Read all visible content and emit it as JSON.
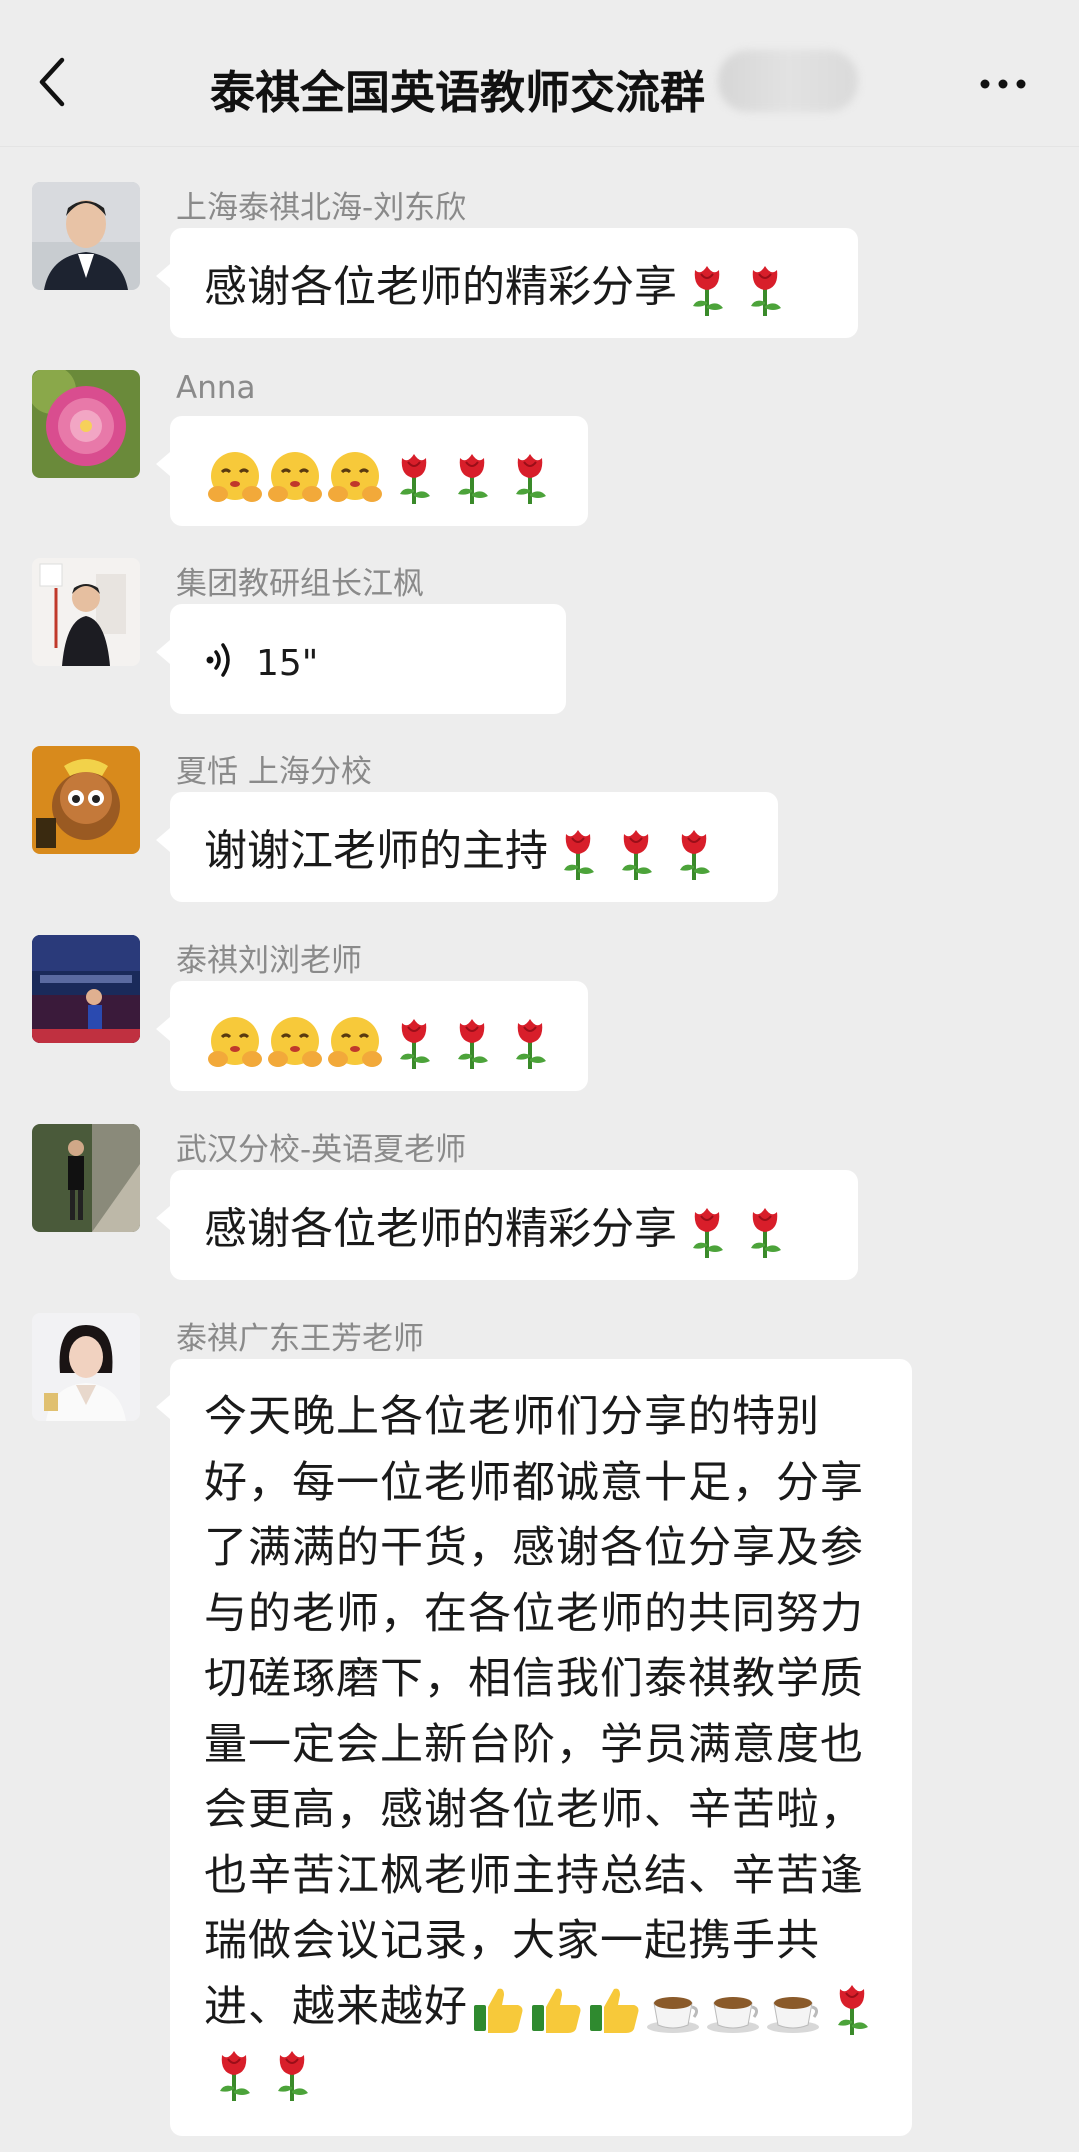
{
  "header": {
    "title": "泰祺全国英语教师交流群"
  },
  "messages": [
    {
      "sender": "上海泰祺北海-刘东欣",
      "text": "感谢各位老师的精彩分享",
      "emojis": [
        "rose",
        "rose"
      ]
    },
    {
      "sender": "Anna",
      "text": "",
      "emojis": [
        "hug",
        "hug",
        "hug",
        "rose",
        "rose",
        "rose"
      ]
    },
    {
      "sender": "集团教研组长江枫",
      "voice_duration": "15\""
    },
    {
      "sender": "夏恬 上海分校",
      "text": "谢谢江老师的主持",
      "emojis": [
        "rose",
        "rose",
        "rose"
      ]
    },
    {
      "sender": "泰祺刘浏老师",
      "text": "",
      "emojis": [
        "hug",
        "hug",
        "hug",
        "rose",
        "rose",
        "rose"
      ]
    },
    {
      "sender": "武汉分校-英语夏老师",
      "text": "感谢各位老师的精彩分享",
      "emojis": [
        "rose",
        "rose"
      ]
    },
    {
      "sender": "泰祺广东王芳老师",
      "lines": [
        "今天晚上各位老师们分享的特别",
        "好，每一位老师都诚意十足，分享",
        "了满满的干货，感谢各位分享及参",
        "与的老师，在各位老师的共同努力",
        "切磋琢磨下，相信我们泰祺教学质",
        "量一定会上新台阶，学员满意度也",
        "会更高，感谢各位老师、辛苦啦，",
        "也辛苦江枫老师主持总结、辛苦逢",
        "瑞做会议记录，大家一起携手共",
        "进、越来越好"
      ],
      "tail_emojis": [
        "thumbs-up",
        "thumbs-up",
        "thumbs-up",
        "coffee",
        "coffee",
        "coffee",
        "rose"
      ],
      "last_line_emojis": [
        "rose",
        "rose"
      ]
    }
  ]
}
